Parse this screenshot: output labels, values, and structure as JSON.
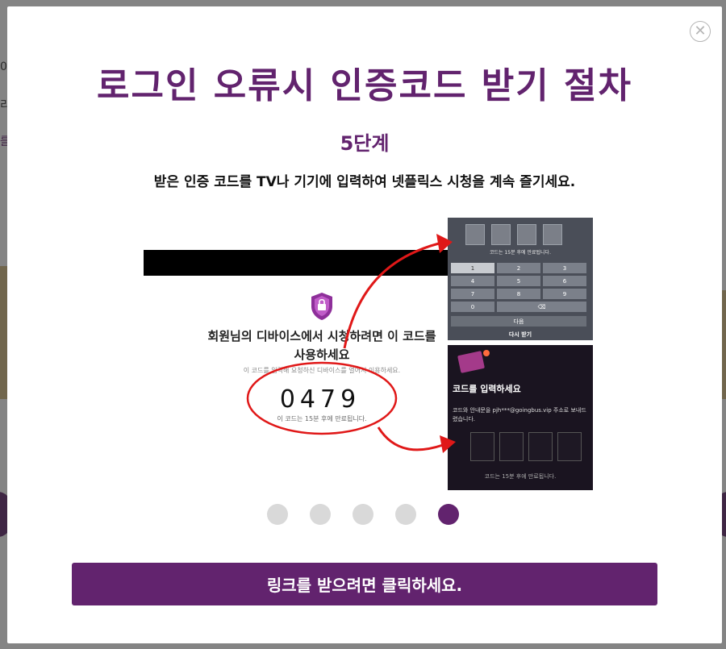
{
  "background": {
    "snippet_1": "0",
    "snippet_2": "리",
    "snippet_3": "를"
  },
  "modal": {
    "title": "로그인 오류시 인증코드 받기 절차",
    "step": "5단계",
    "description": "받은 인증 코드를 TV나 기기에 입력하여 넷플릭스 시청을 계속 즐기세요.",
    "close_symbol": "✕",
    "cta_label": "링크를 받으려면 클릭하세요."
  },
  "illustration": {
    "phone_title": "회원님의 디바이스에서 시청하려면 이 코드를 사용하세요",
    "phone_subtitle": "이 코드를 입력해 요청하신 디바이스를 열어서 이용하세요.",
    "code": "0479",
    "code_expiry": "이 코드는 15분 후에 만료됩니다.",
    "tv_hint": "코드는 15분 후에 만료됩니다.",
    "keypad": [
      "1",
      "2",
      "3",
      "4",
      "5",
      "6",
      "7",
      "8",
      "9",
      "0",
      "⌫"
    ],
    "tv_next": "다음",
    "tv_resend": "다시 받기",
    "email_title": "코드를 입력하세요",
    "email_body": "코드와 안내문을 pjh***@goingbus.vip 주소로 보내드렸습니다.",
    "email_expiry": "코드는 15분 후에 만료됩니다."
  },
  "pagination": {
    "total": 5,
    "active_index": 4
  },
  "colors": {
    "brand_purple": "#62236e",
    "dot_inactive": "#d9d9d9",
    "arrow_red": "#e01818"
  }
}
